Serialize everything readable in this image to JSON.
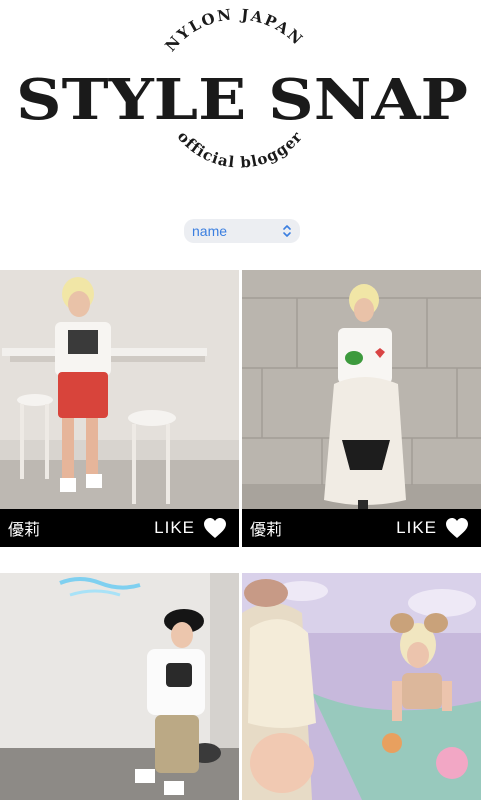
{
  "header": {
    "brand_top": "NYLON JAPAN",
    "title": "STYLE SNAP",
    "subtitle": "official blogger"
  },
  "filter": {
    "selected": "name",
    "icon": "chevron-updown-icon"
  },
  "posts": [
    {
      "author": "優莉",
      "like_label": "LIKE",
      "icon": "heart-icon"
    },
    {
      "author": "優莉",
      "like_label": "LIKE",
      "icon": "heart-icon"
    },
    {
      "author": "",
      "like_label": "",
      "icon": ""
    },
    {
      "author": "",
      "like_label": "",
      "icon": ""
    }
  ],
  "colors": {
    "accent": "#3b7fe0",
    "bar": "#000000",
    "text": "#1a1a1a"
  }
}
